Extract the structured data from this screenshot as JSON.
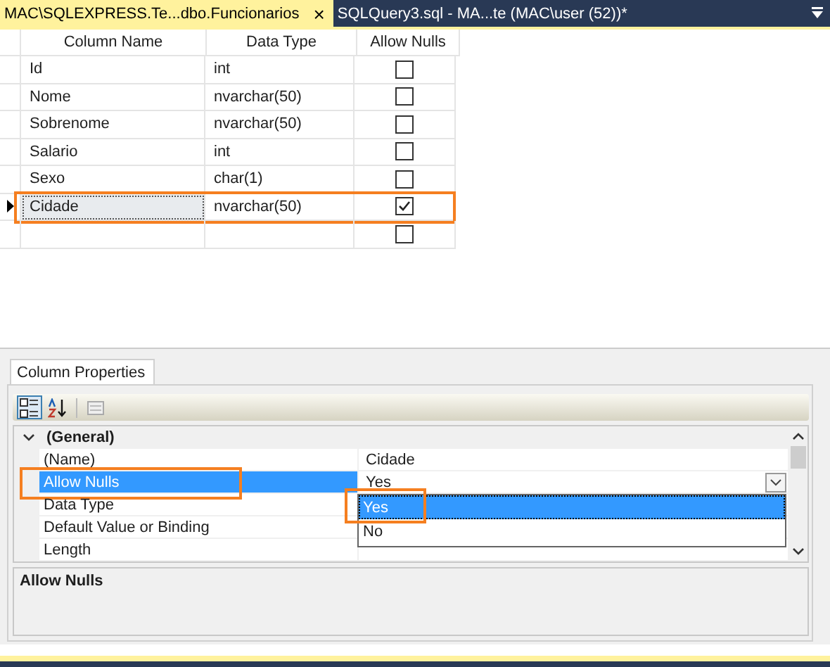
{
  "tabs": [
    {
      "label": "MAC\\SQLEXPRESS.Te...dbo.Funcionarios",
      "selected": true,
      "close": "×"
    },
    {
      "label": "SQLQuery3.sql - MA...te (MAC\\user (52))*",
      "selected": false
    }
  ],
  "table": {
    "columns": [
      "Column Name",
      "Data Type",
      "Allow Nulls"
    ],
    "rows": [
      {
        "name": "Id",
        "type": "int",
        "allow_nulls": false,
        "selected": false,
        "highlighted": false
      },
      {
        "name": "Nome",
        "type": "nvarchar(50)",
        "allow_nulls": false,
        "selected": false,
        "highlighted": false
      },
      {
        "name": "Sobrenome",
        "type": "nvarchar(50)",
        "allow_nulls": false,
        "selected": false,
        "highlighted": false
      },
      {
        "name": "Salario",
        "type": "int",
        "allow_nulls": false,
        "selected": false,
        "highlighted": false
      },
      {
        "name": "Sexo",
        "type": "char(1)",
        "allow_nulls": false,
        "selected": false,
        "highlighted": false
      },
      {
        "name": "Cidade",
        "type": "nvarchar(50)",
        "allow_nulls": true,
        "selected": true,
        "highlighted": true
      },
      {
        "name": "",
        "type": "",
        "allow_nulls": false,
        "selected": false,
        "highlighted": false
      }
    ]
  },
  "properties": {
    "tab": "Column Properties",
    "toolbar": [
      {
        "kind": "categorized",
        "selected": true
      },
      {
        "kind": "alphabetical",
        "selected": false
      },
      {
        "kind": "pages",
        "selected": false
      }
    ],
    "category": {
      "label": "(General)",
      "expanded": true
    },
    "rows": [
      {
        "name": "(Name)",
        "value": "Cidade",
        "selected": false,
        "highlighted": false
      },
      {
        "name": "Allow Nulls",
        "value": "Yes",
        "selected": true,
        "highlighted": true
      },
      {
        "name": "Data Type",
        "selected": false,
        "highlighted": false
      },
      {
        "name": "Default Value or Binding",
        "selected": false,
        "highlighted": false
      },
      {
        "name": "Length",
        "selected": false,
        "highlighted": false
      }
    ],
    "dropdown": {
      "options": [
        {
          "label": "Yes",
          "selected": true,
          "highlighted": true
        },
        {
          "label": "No",
          "selected": false,
          "highlighted": false
        }
      ]
    },
    "description": "Allow Nulls"
  }
}
